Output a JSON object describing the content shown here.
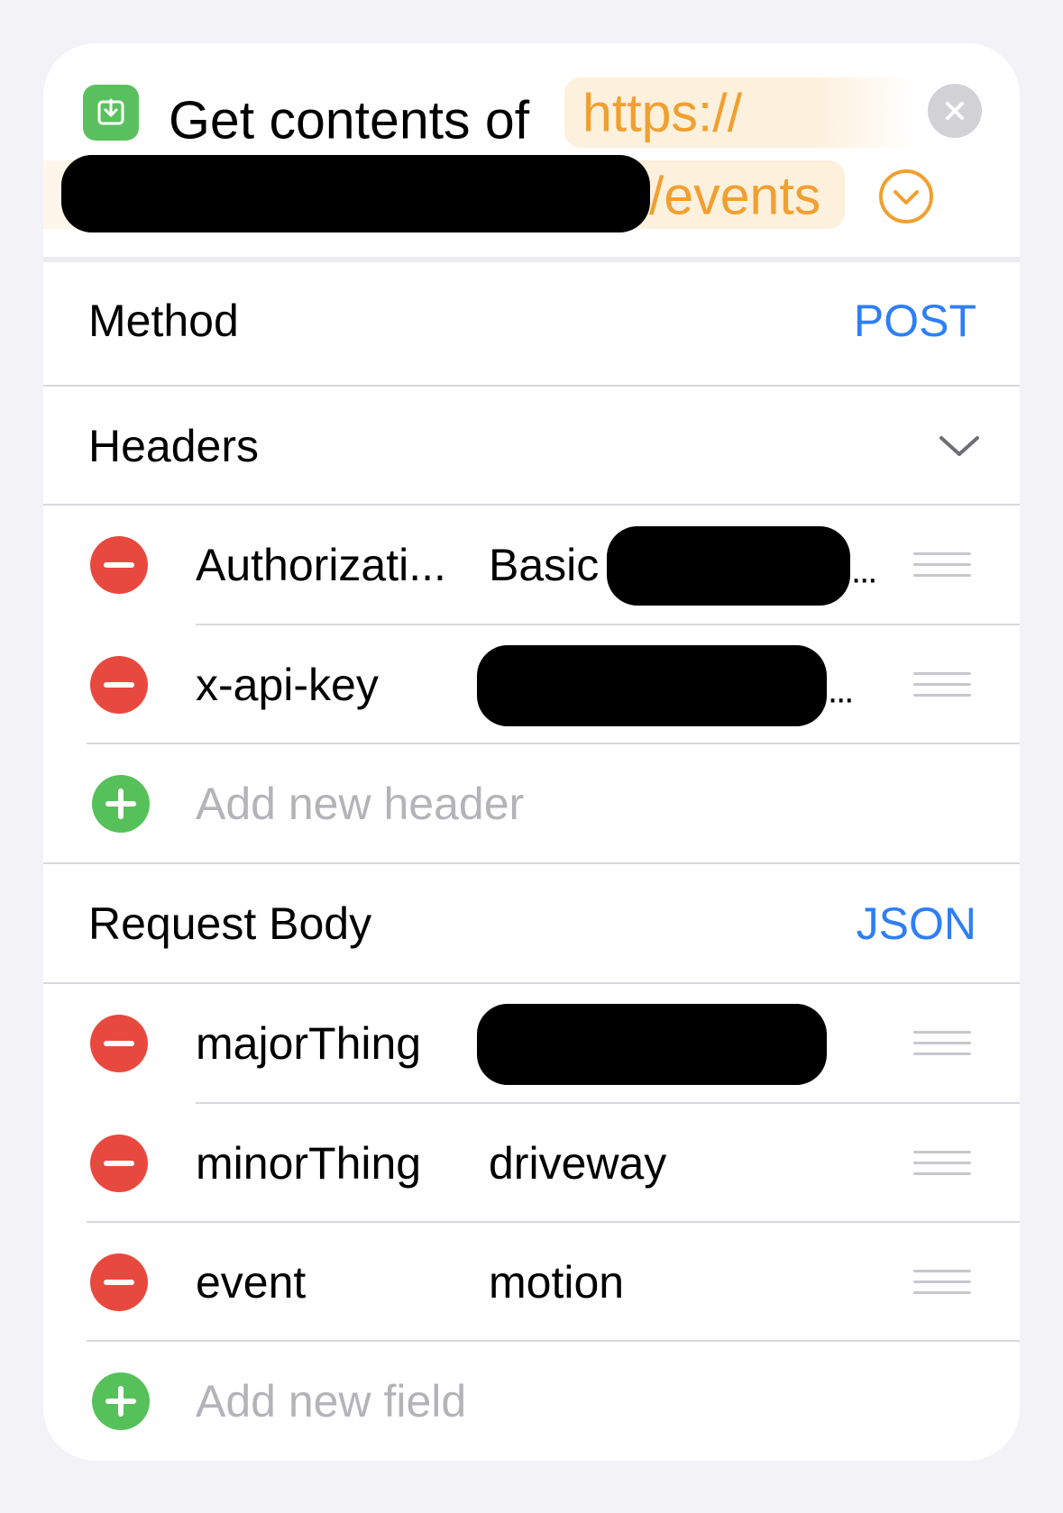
{
  "action": {
    "title": "Get contents of",
    "url_prefix": "https://",
    "url_suffix": "/events",
    "icon": "download-icon"
  },
  "method": {
    "label": "Method",
    "value": "POST"
  },
  "headers": {
    "label": "Headers",
    "items": [
      {
        "key": "Authorizati...",
        "value": "Basic",
        "value_ellipsis": "..."
      },
      {
        "key": "x-api-key",
        "value": "",
        "value_ellipsis": "..."
      }
    ],
    "add_placeholder": "Add new header"
  },
  "request_body": {
    "label": "Request Body",
    "type": "JSON",
    "fields": [
      {
        "key": "majorThing",
        "value": ""
      },
      {
        "key": "minorThing",
        "value": "driveway"
      },
      {
        "key": "event",
        "value": "motion"
      }
    ],
    "add_placeholder": "Add new field"
  },
  "colors": {
    "accent_blue": "#2f7ef6",
    "variable_orange": "#f0a030",
    "delete_red": "#e8493f",
    "add_green": "#56c15a"
  }
}
